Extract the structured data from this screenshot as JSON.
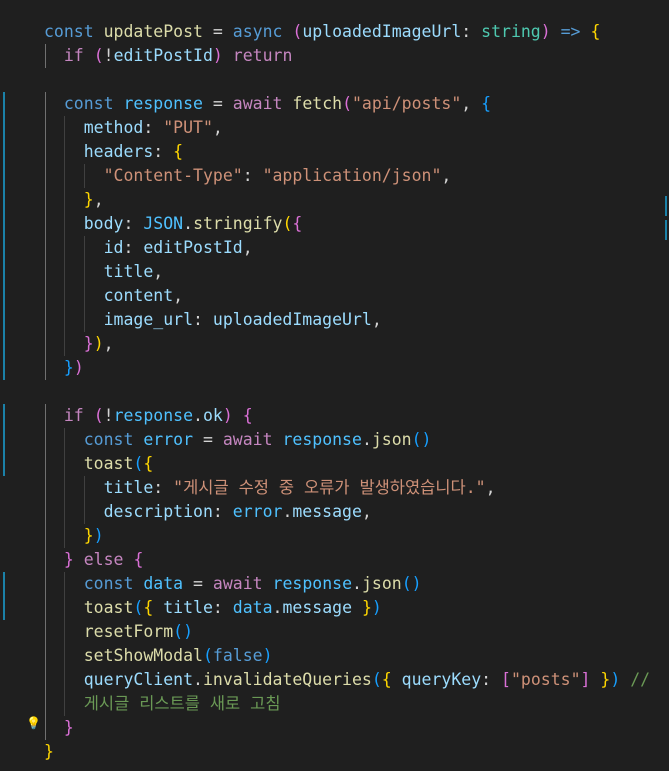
{
  "editor": {
    "language": "typescript",
    "comment_trailing": "//",
    "comment_text": "게시글 리스트를 새로 고침",
    "lines": [
      [
        [
          "kw",
          "const"
        ],
        [
          "p",
          " "
        ],
        [
          "fn",
          "updatePost"
        ],
        [
          "p",
          " = "
        ],
        [
          "kw",
          "async"
        ],
        [
          "p",
          " "
        ],
        [
          "b2",
          "("
        ],
        [
          "var",
          "uploadedImageUrl"
        ],
        [
          "p",
          ": "
        ],
        [
          "type",
          "string"
        ],
        [
          "b2",
          ")"
        ],
        [
          "p",
          " "
        ],
        [
          "kw",
          "=>"
        ],
        [
          "p",
          " "
        ],
        [
          "b1",
          "{"
        ]
      ],
      [
        [
          "p",
          "  "
        ],
        [
          "ctl",
          "if"
        ],
        [
          "p",
          " "
        ],
        [
          "b2",
          "("
        ],
        [
          "p",
          "!"
        ],
        [
          "var",
          "editPostId"
        ],
        [
          "b2",
          ")"
        ],
        [
          "p",
          " "
        ],
        [
          "ctl",
          "return"
        ]
      ],
      [],
      [
        [
          "p",
          "  "
        ],
        [
          "kw",
          "const"
        ],
        [
          "p",
          " "
        ],
        [
          "cst",
          "response"
        ],
        [
          "p",
          " = "
        ],
        [
          "ctl",
          "await"
        ],
        [
          "p",
          " "
        ],
        [
          "fn",
          "fetch"
        ],
        [
          "b2",
          "("
        ],
        [
          "str",
          "\"api/posts\""
        ],
        [
          "p",
          ", "
        ],
        [
          "b3",
          "{"
        ]
      ],
      [
        [
          "p",
          "    "
        ],
        [
          "var",
          "method"
        ],
        [
          "p",
          ": "
        ],
        [
          "str",
          "\"PUT\""
        ],
        [
          "p",
          ","
        ]
      ],
      [
        [
          "p",
          "    "
        ],
        [
          "var",
          "headers"
        ],
        [
          "p",
          ": "
        ],
        [
          "b1",
          "{"
        ]
      ],
      [
        [
          "p",
          "      "
        ],
        [
          "str",
          "\"Content-Type\""
        ],
        [
          "p",
          ": "
        ],
        [
          "str",
          "\"application/json\""
        ],
        [
          "p",
          ","
        ]
      ],
      [
        [
          "p",
          "    "
        ],
        [
          "b1",
          "}"
        ],
        [
          "p",
          ","
        ]
      ],
      [
        [
          "p",
          "    "
        ],
        [
          "var",
          "body"
        ],
        [
          "p",
          ": "
        ],
        [
          "cst",
          "JSON"
        ],
        [
          "p",
          "."
        ],
        [
          "fn",
          "stringify"
        ],
        [
          "b1",
          "("
        ],
        [
          "b2",
          "{"
        ]
      ],
      [
        [
          "p",
          "      "
        ],
        [
          "var",
          "id"
        ],
        [
          "p",
          ": "
        ],
        [
          "var",
          "editPostId"
        ],
        [
          "p",
          ","
        ]
      ],
      [
        [
          "p",
          "      "
        ],
        [
          "var",
          "title"
        ],
        [
          "p",
          ","
        ]
      ],
      [
        [
          "p",
          "      "
        ],
        [
          "var",
          "content"
        ],
        [
          "p",
          ","
        ]
      ],
      [
        [
          "p",
          "      "
        ],
        [
          "var",
          "image_url"
        ],
        [
          "p",
          ": "
        ],
        [
          "var",
          "uploadedImageUrl"
        ],
        [
          "p",
          ","
        ]
      ],
      [
        [
          "p",
          "    "
        ],
        [
          "b2",
          "}"
        ],
        [
          "b1",
          ")"
        ],
        [
          "p",
          ","
        ]
      ],
      [
        [
          "p",
          "  "
        ],
        [
          "b3",
          "}"
        ],
        [
          "b2",
          ")"
        ]
      ],
      [],
      [
        [
          "p",
          "  "
        ],
        [
          "ctl",
          "if"
        ],
        [
          "p",
          " "
        ],
        [
          "b2",
          "("
        ],
        [
          "p",
          "!"
        ],
        [
          "cst",
          "response"
        ],
        [
          "p",
          "."
        ],
        [
          "var",
          "ok"
        ],
        [
          "b2",
          ")"
        ],
        [
          "p",
          " "
        ],
        [
          "b2",
          "{"
        ]
      ],
      [
        [
          "p",
          "    "
        ],
        [
          "kw",
          "const"
        ],
        [
          "p",
          " "
        ],
        [
          "cst",
          "error"
        ],
        [
          "p",
          " = "
        ],
        [
          "ctl",
          "await"
        ],
        [
          "p",
          " "
        ],
        [
          "cst",
          "response"
        ],
        [
          "p",
          "."
        ],
        [
          "fn",
          "json"
        ],
        [
          "b3",
          "()"
        ]
      ],
      [
        [
          "p",
          "    "
        ],
        [
          "fn",
          "toast"
        ],
        [
          "b3",
          "("
        ],
        [
          "b1",
          "{"
        ]
      ],
      [
        [
          "p",
          "      "
        ],
        [
          "var",
          "title"
        ],
        [
          "p",
          ": "
        ],
        [
          "str",
          "\"게시글 수정 중 오류가 발생하였습니다.\""
        ],
        [
          "p",
          ","
        ]
      ],
      [
        [
          "p",
          "      "
        ],
        [
          "var",
          "description"
        ],
        [
          "p",
          ": "
        ],
        [
          "cst",
          "error"
        ],
        [
          "p",
          "."
        ],
        [
          "var",
          "message"
        ],
        [
          "p",
          ","
        ]
      ],
      [
        [
          "p",
          "    "
        ],
        [
          "b1",
          "}"
        ],
        [
          "b3",
          ")"
        ]
      ],
      [
        [
          "p",
          "  "
        ],
        [
          "b2",
          "}"
        ],
        [
          "p",
          " "
        ],
        [
          "ctl",
          "else"
        ],
        [
          "p",
          " "
        ],
        [
          "b2",
          "{"
        ]
      ],
      [
        [
          "p",
          "    "
        ],
        [
          "kw",
          "const"
        ],
        [
          "p",
          " "
        ],
        [
          "cst",
          "data"
        ],
        [
          "p",
          " = "
        ],
        [
          "ctl",
          "await"
        ],
        [
          "p",
          " "
        ],
        [
          "cst",
          "response"
        ],
        [
          "p",
          "."
        ],
        [
          "fn",
          "json"
        ],
        [
          "b3",
          "()"
        ]
      ],
      [
        [
          "p",
          "    "
        ],
        [
          "fn",
          "toast"
        ],
        [
          "b3",
          "("
        ],
        [
          "b1",
          "{"
        ],
        [
          "p",
          " "
        ],
        [
          "var",
          "title"
        ],
        [
          "p",
          ": "
        ],
        [
          "cst",
          "data"
        ],
        [
          "p",
          "."
        ],
        [
          "var",
          "message"
        ],
        [
          "p",
          " "
        ],
        [
          "b1",
          "}"
        ],
        [
          "b3",
          ")"
        ]
      ],
      [
        [
          "p",
          "    "
        ],
        [
          "fn",
          "resetForm"
        ],
        [
          "b3",
          "()"
        ]
      ],
      [
        [
          "p",
          "    "
        ],
        [
          "fn",
          "setShowModal"
        ],
        [
          "b3",
          "("
        ],
        [
          "kw",
          "false"
        ],
        [
          "b3",
          ")"
        ]
      ],
      [
        [
          "p",
          "    "
        ],
        [
          "var",
          "queryClient"
        ],
        [
          "p",
          "."
        ],
        [
          "fn",
          "invalidateQueries"
        ],
        [
          "b3",
          "("
        ],
        [
          "b1",
          "{"
        ],
        [
          "p",
          " "
        ],
        [
          "var",
          "queryKey"
        ],
        [
          "p",
          ": "
        ],
        [
          "b2",
          "["
        ],
        [
          "str",
          "\"posts\""
        ],
        [
          "b2",
          "]"
        ],
        [
          "p",
          " "
        ],
        [
          "b1",
          "}"
        ],
        [
          "b3",
          ")"
        ],
        [
          "p",
          " "
        ],
        [
          "cmt",
          "//"
        ]
      ],
      [
        [
          "p",
          "    "
        ],
        [
          "cmt",
          "게시글 리스트를 새로 고침"
        ]
      ],
      [
        [
          "p",
          "  "
        ],
        [
          "b2",
          "}"
        ]
      ],
      [
        [
          "b1",
          "}"
        ]
      ]
    ]
  },
  "colors": {
    "background": "#1f1f1f",
    "gutter_change": "#1b81a8",
    "lightbulb": "#ffcc00"
  },
  "icons": {
    "lightbulb": "lightbulb-icon"
  }
}
